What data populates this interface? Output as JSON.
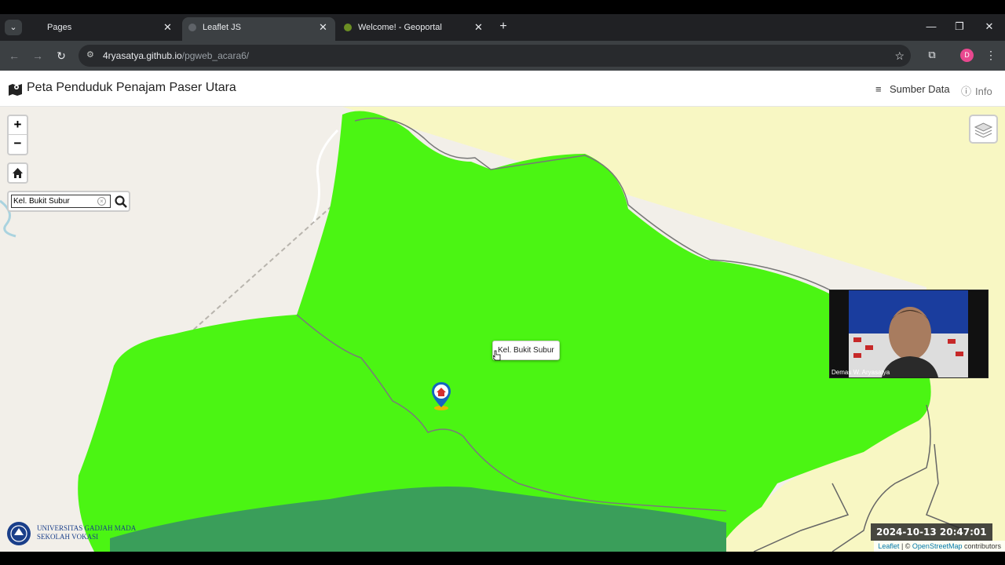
{
  "browser": {
    "tabs": [
      {
        "label": "Pages",
        "active": false
      },
      {
        "label": "Leaflet JS",
        "active": true
      },
      {
        "label": "Welcome! - Geoportal",
        "active": false
      }
    ],
    "url_host": "4ryasatya.github.io",
    "url_path": "/pgweb_acara6/",
    "profile_initial": "D"
  },
  "header": {
    "title": "Peta Penduduk Penajam Paser Utara",
    "links": [
      "Sumber Data",
      "Info"
    ]
  },
  "map": {
    "search": {
      "value": "Kel. Bukit Subur"
    },
    "tooltip": "Kel. Bukit Subur",
    "zoom_in": "+",
    "zoom_out": "−",
    "colors": {
      "polygon": "#4bf513",
      "forest": "#3a9e5a",
      "land": "#f2efe9",
      "sand": "#f8f7c3",
      "water": "#aad3df"
    }
  },
  "webcam": {
    "name": "Demas W. Aryasatya"
  },
  "timestamp": "2024-10-13  20:47:01",
  "attribution": {
    "leaflet": "Leaflet",
    "sep": " | © ",
    "osm": "OpenStreetMap",
    "suffix": " contributors"
  },
  "logo": {
    "line1": "UNIVERSITAS GADJAH MADA",
    "line2": "SEKOLAH VOKASI"
  }
}
